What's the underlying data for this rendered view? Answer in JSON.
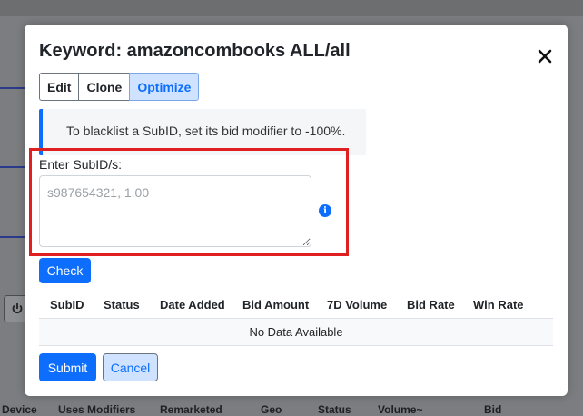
{
  "background": {
    "columns": [
      "Device",
      "Uses Modifiers",
      "Remarketed",
      "Geo",
      "Status",
      "Volume~",
      "Bid"
    ]
  },
  "modal": {
    "title": "Keyword: amazoncombooks ALL/all",
    "close_icon": "close-icon",
    "tabs": [
      {
        "label": "Edit",
        "active": false
      },
      {
        "label": "Clone",
        "active": false
      },
      {
        "label": "Optimize",
        "active": true
      }
    ],
    "alert_text": "To blacklist a SubID, set its bid modifier to -100%.",
    "subid": {
      "label": "Enter SubID/s:",
      "placeholder": "s987654321, 1.00",
      "value": "",
      "info_icon": "info-icon"
    },
    "check_label": "Check",
    "table": {
      "columns": [
        "SubID",
        "Status",
        "Date Added",
        "Bid Amount",
        "7D Volume",
        "Bid Rate",
        "Win Rate"
      ],
      "empty_text": "No Data Available"
    },
    "submit_label": "Submit",
    "cancel_label": "Cancel"
  },
  "colors": {
    "primary": "#0d6efd",
    "highlight": "#e02020",
    "overlay": "#7b7d80"
  }
}
